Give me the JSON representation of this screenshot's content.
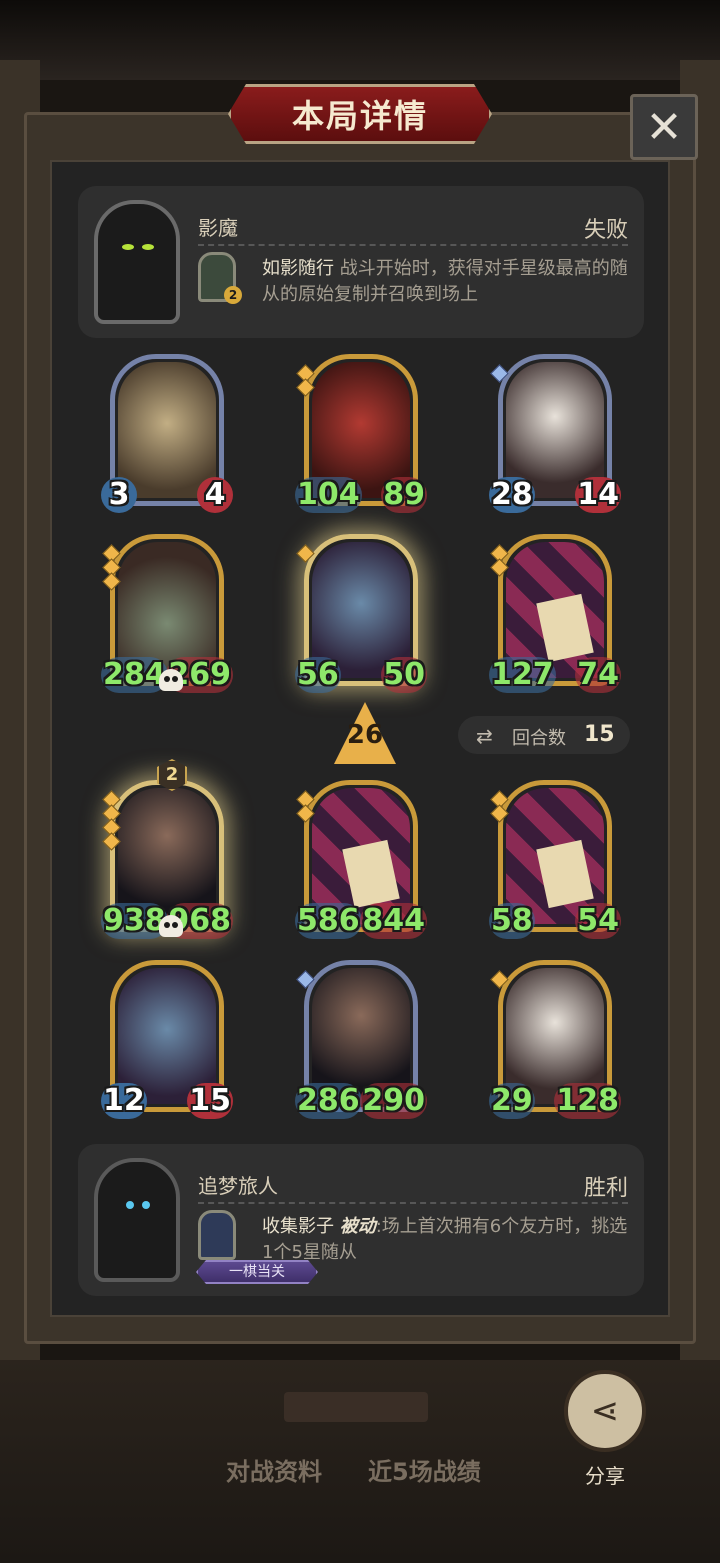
{
  "title": "本局详情",
  "close_label": "✕",
  "opponent": {
    "name": "影魔",
    "result": "失败",
    "hero_level": "2",
    "skill_name": "如影随行",
    "skill_desc": " 战斗开始时，获得对手星级最高的随从的原始复制并召唤到场上"
  },
  "opponent_board": [
    {
      "atk": "3",
      "hp": "4",
      "art": "bat",
      "frame": "silver",
      "stars": 0
    },
    {
      "atk": "104",
      "hp": "89",
      "art": "demon",
      "frame": "gold",
      "stars": 2
    },
    {
      "atk": "28",
      "hp": "14",
      "art": "rabbit",
      "frame": "silver",
      "stars": 1
    },
    {
      "atk": "284",
      "hp": "269",
      "art": "witch",
      "frame": "gold",
      "stars": 3
    },
    {
      "atk": "56",
      "hp": "50",
      "art": "elf",
      "frame": "glow",
      "stars": 1
    },
    {
      "atk": "127",
      "hp": "74",
      "art": "harlequin",
      "frame": "gold",
      "stars": 2
    }
  ],
  "tier": "26",
  "rounds": {
    "label": "回合数",
    "value": "15"
  },
  "player_board": [
    {
      "atk": "938",
      "hp": "968",
      "art": "gent",
      "frame": "glow",
      "stars": 4,
      "level": "2"
    },
    {
      "atk": "586",
      "hp": "844",
      "art": "harlequin",
      "frame": "gold",
      "stars": 2
    },
    {
      "atk": "58",
      "hp": "54",
      "art": "harlequin",
      "frame": "gold",
      "stars": 2
    },
    {
      "atk": "12",
      "hp": "15",
      "art": "elf",
      "frame": "gold",
      "stars": 0
    },
    {
      "atk": "286",
      "hp": "290",
      "art": "gent",
      "frame": "silver",
      "stars": 1
    },
    {
      "atk": "29",
      "hp": "128",
      "art": "rabbit",
      "frame": "gold",
      "stars": 1
    }
  ],
  "player": {
    "name": "追梦旅人",
    "result": "胜利",
    "skill_name": "收集影子",
    "skill_tag": "被动",
    "skill_desc": ":场上首次拥有6个友方时，挑选1个5星随从",
    "title_badge": "一棋当关"
  },
  "tabs": [
    "对战资料",
    "近5场战绩"
  ],
  "share_label": "分享"
}
